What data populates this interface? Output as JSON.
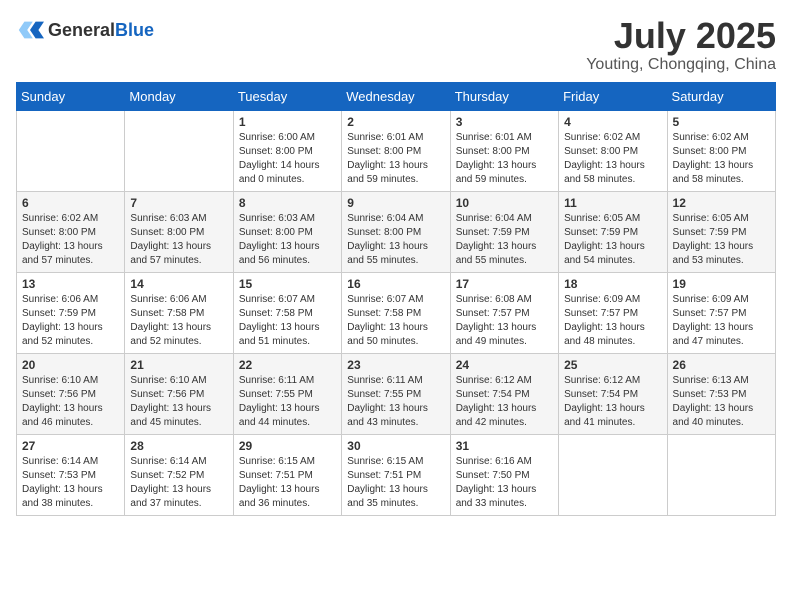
{
  "header": {
    "logo_general": "General",
    "logo_blue": "Blue",
    "month": "July 2025",
    "location": "Youting, Chongqing, China"
  },
  "weekdays": [
    "Sunday",
    "Monday",
    "Tuesday",
    "Wednesday",
    "Thursday",
    "Friday",
    "Saturday"
  ],
  "weeks": [
    [
      {
        "day": "",
        "info": ""
      },
      {
        "day": "",
        "info": ""
      },
      {
        "day": "1",
        "info": "Sunrise: 6:00 AM\nSunset: 8:00 PM\nDaylight: 14 hours\nand 0 minutes."
      },
      {
        "day": "2",
        "info": "Sunrise: 6:01 AM\nSunset: 8:00 PM\nDaylight: 13 hours\nand 59 minutes."
      },
      {
        "day": "3",
        "info": "Sunrise: 6:01 AM\nSunset: 8:00 PM\nDaylight: 13 hours\nand 59 minutes."
      },
      {
        "day": "4",
        "info": "Sunrise: 6:02 AM\nSunset: 8:00 PM\nDaylight: 13 hours\nand 58 minutes."
      },
      {
        "day": "5",
        "info": "Sunrise: 6:02 AM\nSunset: 8:00 PM\nDaylight: 13 hours\nand 58 minutes."
      }
    ],
    [
      {
        "day": "6",
        "info": "Sunrise: 6:02 AM\nSunset: 8:00 PM\nDaylight: 13 hours\nand 57 minutes."
      },
      {
        "day": "7",
        "info": "Sunrise: 6:03 AM\nSunset: 8:00 PM\nDaylight: 13 hours\nand 57 minutes."
      },
      {
        "day": "8",
        "info": "Sunrise: 6:03 AM\nSunset: 8:00 PM\nDaylight: 13 hours\nand 56 minutes."
      },
      {
        "day": "9",
        "info": "Sunrise: 6:04 AM\nSunset: 8:00 PM\nDaylight: 13 hours\nand 55 minutes."
      },
      {
        "day": "10",
        "info": "Sunrise: 6:04 AM\nSunset: 7:59 PM\nDaylight: 13 hours\nand 55 minutes."
      },
      {
        "day": "11",
        "info": "Sunrise: 6:05 AM\nSunset: 7:59 PM\nDaylight: 13 hours\nand 54 minutes."
      },
      {
        "day": "12",
        "info": "Sunrise: 6:05 AM\nSunset: 7:59 PM\nDaylight: 13 hours\nand 53 minutes."
      }
    ],
    [
      {
        "day": "13",
        "info": "Sunrise: 6:06 AM\nSunset: 7:59 PM\nDaylight: 13 hours\nand 52 minutes."
      },
      {
        "day": "14",
        "info": "Sunrise: 6:06 AM\nSunset: 7:58 PM\nDaylight: 13 hours\nand 52 minutes."
      },
      {
        "day": "15",
        "info": "Sunrise: 6:07 AM\nSunset: 7:58 PM\nDaylight: 13 hours\nand 51 minutes."
      },
      {
        "day": "16",
        "info": "Sunrise: 6:07 AM\nSunset: 7:58 PM\nDaylight: 13 hours\nand 50 minutes."
      },
      {
        "day": "17",
        "info": "Sunrise: 6:08 AM\nSunset: 7:57 PM\nDaylight: 13 hours\nand 49 minutes."
      },
      {
        "day": "18",
        "info": "Sunrise: 6:09 AM\nSunset: 7:57 PM\nDaylight: 13 hours\nand 48 minutes."
      },
      {
        "day": "19",
        "info": "Sunrise: 6:09 AM\nSunset: 7:57 PM\nDaylight: 13 hours\nand 47 minutes."
      }
    ],
    [
      {
        "day": "20",
        "info": "Sunrise: 6:10 AM\nSunset: 7:56 PM\nDaylight: 13 hours\nand 46 minutes."
      },
      {
        "day": "21",
        "info": "Sunrise: 6:10 AM\nSunset: 7:56 PM\nDaylight: 13 hours\nand 45 minutes."
      },
      {
        "day": "22",
        "info": "Sunrise: 6:11 AM\nSunset: 7:55 PM\nDaylight: 13 hours\nand 44 minutes."
      },
      {
        "day": "23",
        "info": "Sunrise: 6:11 AM\nSunset: 7:55 PM\nDaylight: 13 hours\nand 43 minutes."
      },
      {
        "day": "24",
        "info": "Sunrise: 6:12 AM\nSunset: 7:54 PM\nDaylight: 13 hours\nand 42 minutes."
      },
      {
        "day": "25",
        "info": "Sunrise: 6:12 AM\nSunset: 7:54 PM\nDaylight: 13 hours\nand 41 minutes."
      },
      {
        "day": "26",
        "info": "Sunrise: 6:13 AM\nSunset: 7:53 PM\nDaylight: 13 hours\nand 40 minutes."
      }
    ],
    [
      {
        "day": "27",
        "info": "Sunrise: 6:14 AM\nSunset: 7:53 PM\nDaylight: 13 hours\nand 38 minutes."
      },
      {
        "day": "28",
        "info": "Sunrise: 6:14 AM\nSunset: 7:52 PM\nDaylight: 13 hours\nand 37 minutes."
      },
      {
        "day": "29",
        "info": "Sunrise: 6:15 AM\nSunset: 7:51 PM\nDaylight: 13 hours\nand 36 minutes."
      },
      {
        "day": "30",
        "info": "Sunrise: 6:15 AM\nSunset: 7:51 PM\nDaylight: 13 hours\nand 35 minutes."
      },
      {
        "day": "31",
        "info": "Sunrise: 6:16 AM\nSunset: 7:50 PM\nDaylight: 13 hours\nand 33 minutes."
      },
      {
        "day": "",
        "info": ""
      },
      {
        "day": "",
        "info": ""
      }
    ]
  ]
}
